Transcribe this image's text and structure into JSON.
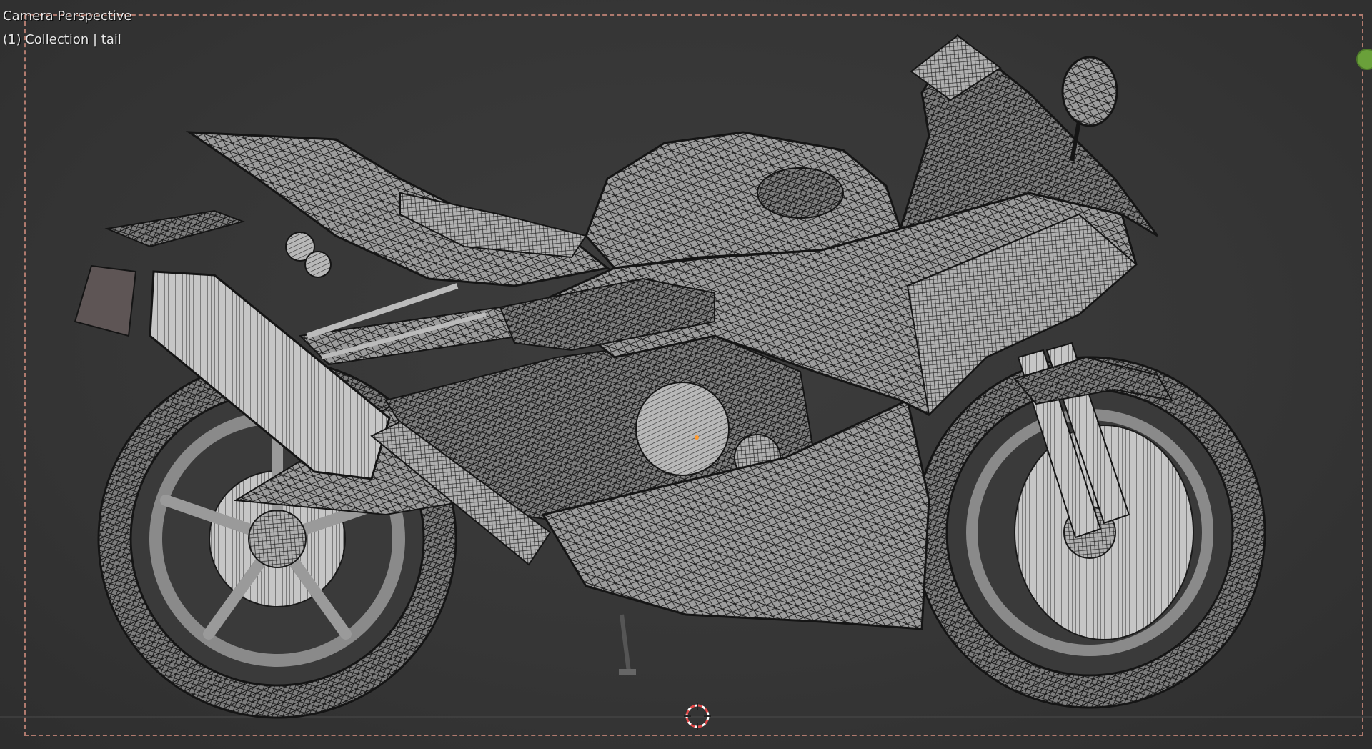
{
  "viewport": {
    "view_label": "Camera Perspective",
    "collection_label": "(1) Collection | tail"
  },
  "icons": {
    "cursor": "3d-cursor-icon",
    "gizmo": "navigation-gizmo-icon"
  },
  "colors": {
    "background": "#363636",
    "camera_frame": "#b07a6e",
    "mesh_fill": "#9a9a9a",
    "wire": "#1a1a1a",
    "gizmo_green": "#6aa03a",
    "cursor_red": "#e04848"
  }
}
